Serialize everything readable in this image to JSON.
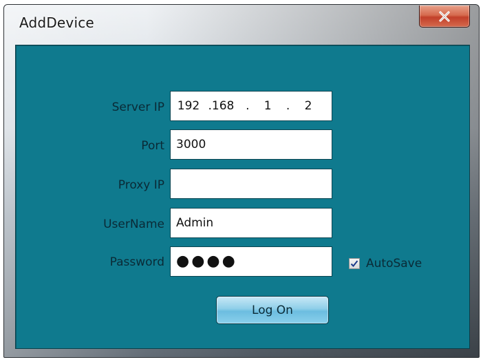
{
  "window": {
    "title": "AddDevice"
  },
  "titlebar": {
    "close_icon": "close-x-icon"
  },
  "form": {
    "server_ip": {
      "label": "Server IP",
      "segments": [
        "192",
        ".168",
        ".",
        "1",
        ".",
        "2"
      ]
    },
    "port": {
      "label": "Port",
      "value": "3000"
    },
    "proxy_ip": {
      "label": "Proxy IP",
      "value": ""
    },
    "username": {
      "label": "UserName",
      "value": "Admin"
    },
    "password": {
      "label": "Password",
      "masked_value": "●●●●"
    },
    "autosave": {
      "label": "AutoSave",
      "checked": true
    },
    "logon_button": {
      "label": "Log On"
    }
  },
  "colors": {
    "client_bg": "#0f7a8e",
    "close_button": "#c2402a",
    "logon_button": "#8fcfe9"
  }
}
